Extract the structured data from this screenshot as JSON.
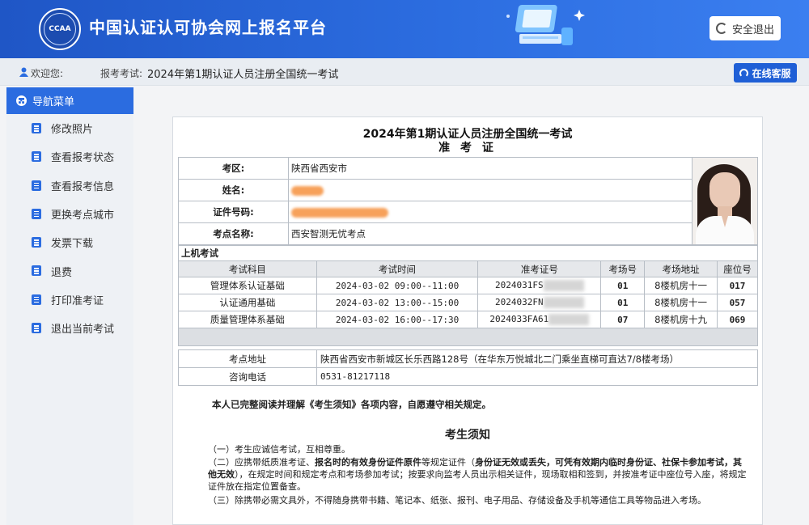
{
  "header": {
    "logo_text": "CCAA",
    "site_title": "中国认证认可协会网上报名平台",
    "logout_label": "安全退出"
  },
  "infobar": {
    "welcome_label": "欢迎您:",
    "username": "",
    "exam_label": "报考考试:",
    "exam_name": "2024年第1期认证人员注册全国统一考试",
    "service_label": "在线客服"
  },
  "sidebar": {
    "head": "导航菜单",
    "items": [
      {
        "label": "修改照片"
      },
      {
        "label": "查看报考状态"
      },
      {
        "label": "查看报考信息"
      },
      {
        "label": "更换考点城市"
      },
      {
        "label": "发票下载"
      },
      {
        "label": "退费"
      },
      {
        "label": "打印准考证"
      },
      {
        "label": "退出当前考试"
      }
    ]
  },
  "ticket": {
    "title": "2024年第1期认证人员注册全国统一考试",
    "subtitle": "准 考 证",
    "info": [
      {
        "label": "考区:",
        "value": "陕西省西安市"
      },
      {
        "label": "姓名:",
        "value": ""
      },
      {
        "label": "证件号码:",
        "value": ""
      },
      {
        "label": "考点名称:",
        "value": "西安智测无忧考点"
      }
    ],
    "section": "上机考试",
    "columns": [
      "考试科目",
      "考试时间",
      "准考证号",
      "考场号",
      "考场地址",
      "座位号"
    ],
    "rows": [
      {
        "subject": "管理体系认证基础",
        "time": "2024-03-02  09:00--11:00",
        "ticket_no": "2024031FS",
        "room": "01",
        "address": "8楼机房十一",
        "seat": "017"
      },
      {
        "subject": "认证通用基础",
        "time": "2024-03-02  13:00--15:00",
        "ticket_no": "2024032FN",
        "room": "01",
        "address": "8楼机房十一",
        "seat": "057"
      },
      {
        "subject": "质量管理体系基础",
        "time": "2024-03-02  16:00--17:30",
        "ticket_no": "2024033FA61",
        "room": "07",
        "address": "8楼机房十九",
        "seat": "069"
      }
    ],
    "venue_address_label": "考点地址",
    "venue_address": "陕西省西安市新城区长乐西路128号（在华东万悦城北二门乘坐直梯可直达7/8楼考场）",
    "phone_label": "咨询电话",
    "phone": "0531-81217118",
    "declaration": "本人已完整阅读并理解《考生须知》各项内容，自愿遵守相关规定。"
  },
  "notice": {
    "title": "考生须知",
    "p1": "（一）考生应诚信考试，互相尊重。",
    "p2_a": "（二）应携带纸质准考证、",
    "p2_b": "报名时的有效身份证件原件",
    "p2_c": "等规定证件（",
    "p2_d": "身份证无效或丢失，可凭有效期内临时身份证、社保卡参加考试，其他无效",
    "p2_e": "），在规定时间和规定考点和考场参加考试；按要求向监考人员出示相关证件，现场取相和签到，并按准考证中座位号入座，将规定证件放在指定位置备查。",
    "p3": "（三）除携带必需文具外，不得随身携带书籍、笔记本、纸张、报刊、电子用品、存储设备及手机等通信工具等物品进入考场。"
  }
}
